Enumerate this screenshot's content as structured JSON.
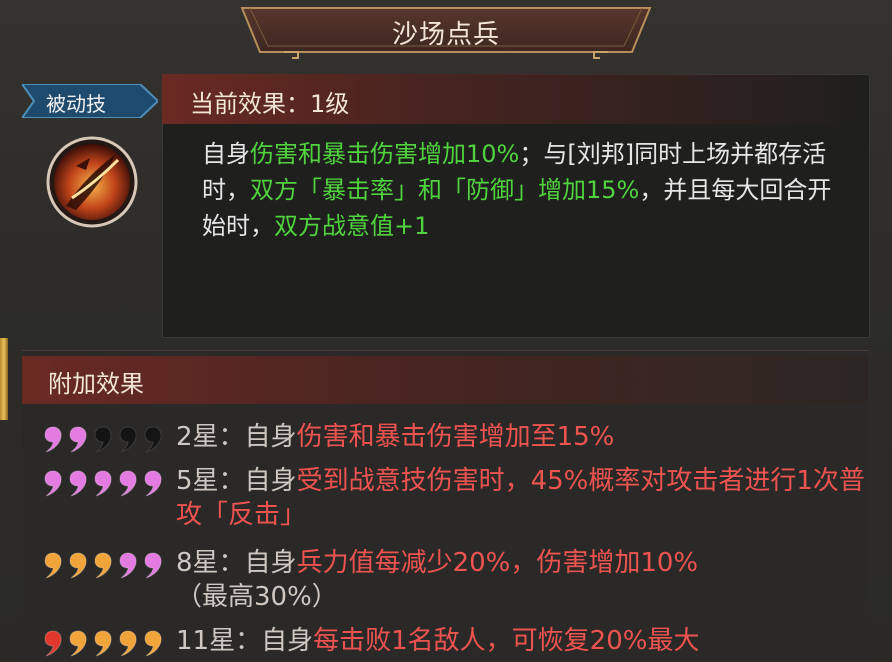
{
  "title": "沙场点兵",
  "badge": "被动技",
  "skill_icon": "sword-slash-icon",
  "current": {
    "header": "当前效果：1级",
    "segments": [
      {
        "t": "自身",
        "c": "w"
      },
      {
        "t": "伤害和暴击伤害增加10%",
        "c": "g"
      },
      {
        "t": "；与[刘邦]同时上场并都存活时，",
        "c": "w"
      },
      {
        "t": "双方「暴击率」和「防御」增加15%",
        "c": "g"
      },
      {
        "t": "，并且每大回合开始时，",
        "c": "w"
      },
      {
        "t": "双方战意值+1",
        "c": "g"
      }
    ]
  },
  "additional": {
    "header": "附加效果",
    "rows": [
      {
        "stars": [
          "pink",
          "pink",
          "black",
          "black",
          "black"
        ],
        "level": "2星：",
        "self": "自身",
        "effect": "伤害和暴击伤害增加至15%",
        "suffix": ""
      },
      {
        "stars": [
          "pink",
          "pink",
          "pink",
          "pink",
          "pink"
        ],
        "level": "5星：",
        "self": "自身",
        "effect": "受到战意技伤害时，45%概率对攻击者进行1次普攻「反击」",
        "suffix": ""
      },
      {
        "stars": [
          "orange",
          "orange",
          "orange",
          "pink",
          "pink"
        ],
        "level": "8星：",
        "self": "自身",
        "effect": "兵力值每减少20%，伤害增加10%",
        "suffix": "（最高30%）"
      },
      {
        "stars": [
          "red",
          "orange",
          "orange",
          "orange",
          "orange"
        ],
        "level": "11星：",
        "self": "自身",
        "effect": "每击败1名敌人，可恢复20%最大",
        "suffix": ""
      }
    ]
  },
  "colors": {
    "green": "#4fd43d",
    "red": "#ef5350",
    "pink": "#e37be0",
    "orange": "#f0a43a",
    "star_red": "#e0382c",
    "black": "#141414"
  }
}
